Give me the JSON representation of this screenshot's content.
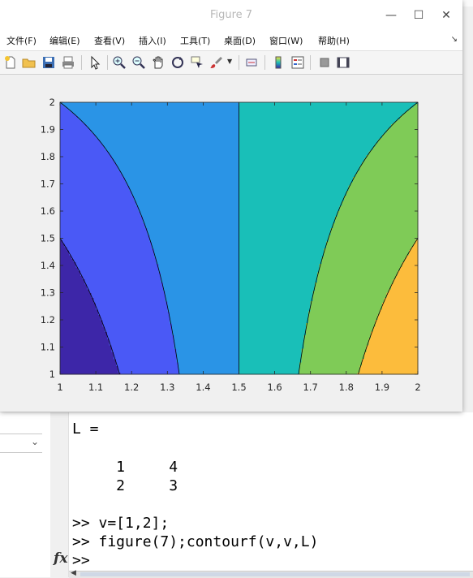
{
  "window": {
    "title": "Figure 7",
    "minimize_icon": "minimize-icon",
    "maximize_icon": "maximize-icon",
    "close_icon": "close-icon"
  },
  "menubar": {
    "items": [
      "文件(F)",
      "编辑(E)",
      "查看(V)",
      "插入(I)",
      "工具(T)",
      "桌面(D)",
      "窗口(W)",
      "帮助(H)"
    ]
  },
  "toolbar": {
    "icons": [
      "new-figure-icon",
      "open-file-icon",
      "save-icon",
      "print-icon",
      "select-arrow-icon",
      "zoom-in-icon",
      "zoom-out-icon",
      "pan-hand-icon",
      "rotate-3d-icon",
      "data-cursor-icon",
      "brush-icon",
      "link-icon",
      "colorbar-icon",
      "legend-icon",
      "hide-plot-tools-icon",
      "show-plot-tools-icon"
    ]
  },
  "chart_data": {
    "type": "contourf",
    "x": [
      1,
      2
    ],
    "y": [
      1,
      2
    ],
    "z": [
      [
        1,
        4
      ],
      [
        2,
        3
      ]
    ],
    "xlim": [
      1,
      2
    ],
    "ylim": [
      1,
      2
    ],
    "xticks": [
      "1",
      "1.1",
      "1.2",
      "1.3",
      "1.4",
      "1.5",
      "1.6",
      "1.7",
      "1.8",
      "1.9",
      "2"
    ],
    "yticks": [
      "1",
      "1.1",
      "1.2",
      "1.3",
      "1.4",
      "1.5",
      "1.6",
      "1.7",
      "1.8",
      "1.9",
      "2"
    ],
    "levels": [
      1,
      1.5,
      2,
      2.5,
      3,
      3.5,
      4
    ],
    "colors": [
      "#3d26a8",
      "#4a59f6",
      "#2a94e6",
      "#19bfb8",
      "#7fcb57",
      "#fcbc3c"
    ],
    "title": "",
    "xlabel": "",
    "ylabel": "",
    "grid": false
  },
  "command_window": {
    "lines": [
      "L =",
      "",
      "",
      "     1     4",
      "     2     3",
      "",
      ">> v=[1,2];",
      ">> figure(7);contourf(v,v,L)",
      ">> "
    ],
    "fx_label": "fx"
  }
}
